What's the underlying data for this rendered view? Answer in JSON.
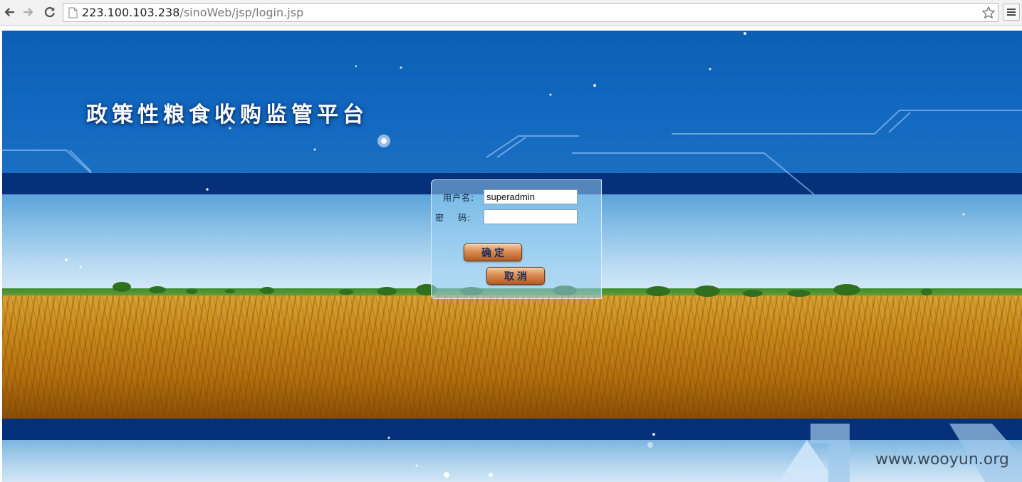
{
  "browser": {
    "url_host": "223.100.103.238",
    "url_path": "/sinoWeb/jsp/login.jsp",
    "icons": [
      "back-icon",
      "forward-icon",
      "reload-icon",
      "page-icon",
      "star-icon",
      "menu-icon"
    ]
  },
  "page": {
    "title": "政策性粮食收购监管平台",
    "login": {
      "username_label": "用户名:",
      "username_value": "superadmin",
      "password_label": "密    码:",
      "password_value": "",
      "confirm_label": "确定",
      "cancel_label": "取消"
    },
    "watermark": "www.wooyun.org"
  },
  "colors": {
    "sky_blue": "#0c5fb4",
    "band_navy": "#06307a",
    "wheat_gold": "#c98a1c",
    "button_copper": "#d98c52"
  }
}
